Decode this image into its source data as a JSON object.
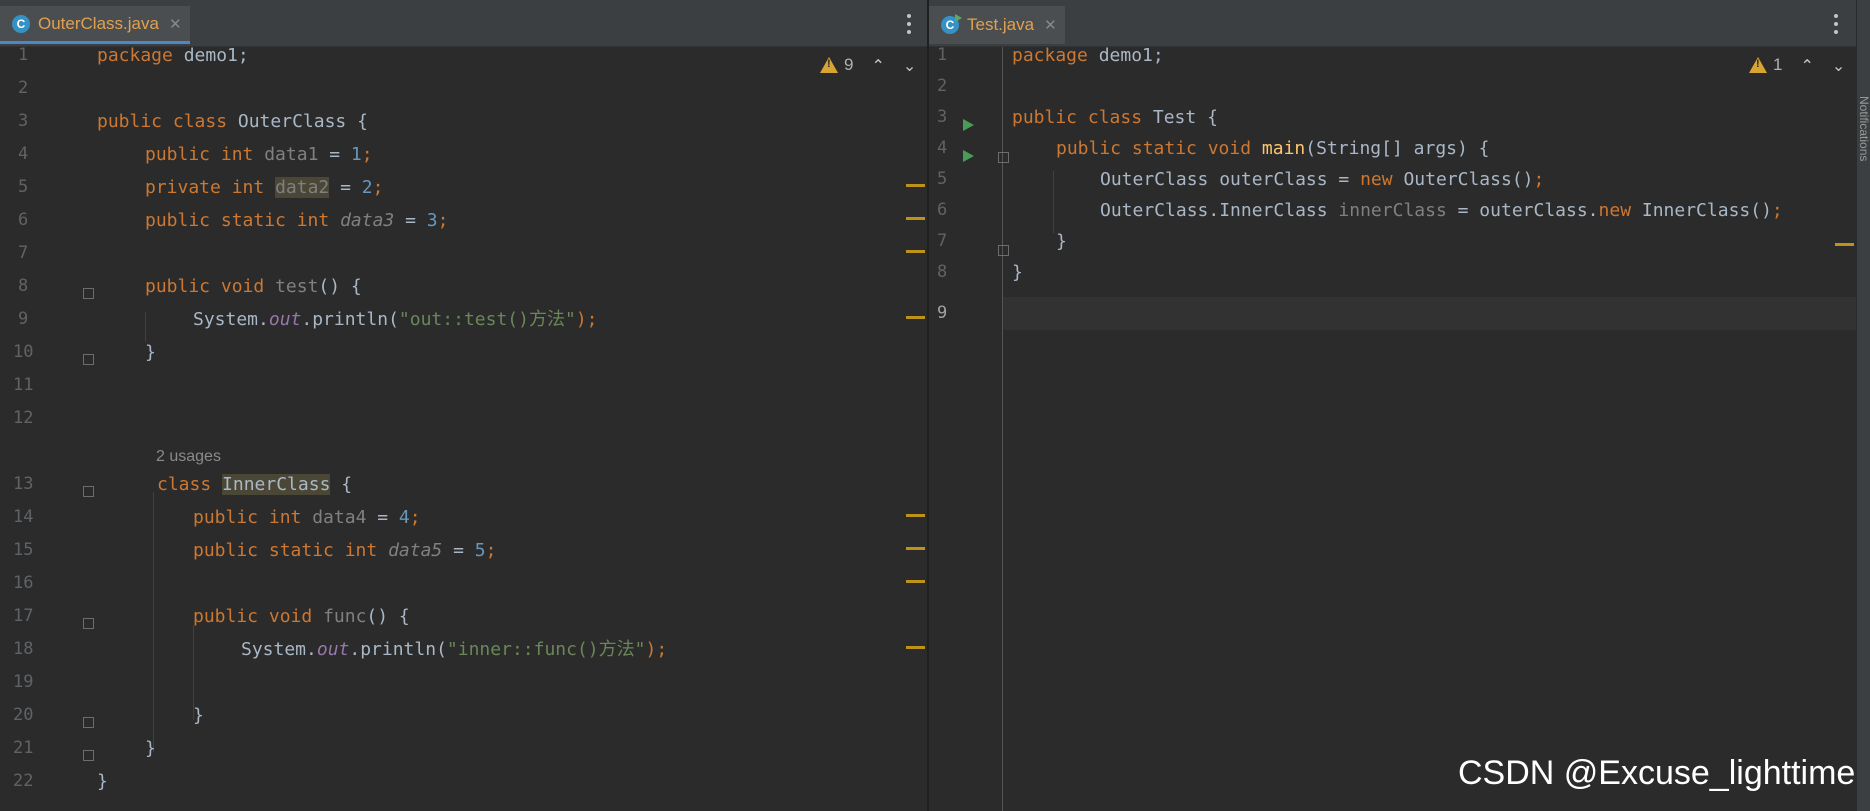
{
  "left": {
    "tab": {
      "icon": "C",
      "name": "OuterClass.java",
      "close": "✕"
    },
    "warnings": {
      "count": "9",
      "up": "⌃",
      "down": "⌄"
    },
    "usages_hint": "2 usages",
    "line_numbers": [
      "1",
      "2",
      "3",
      "4",
      "5",
      "6",
      "7",
      "8",
      "9",
      "10",
      "11",
      "12",
      "13",
      "14",
      "15",
      "16",
      "17",
      "18",
      "19",
      "20",
      "21",
      "22"
    ],
    "code": {
      "l1a": "package",
      "l1b": " demo1;",
      "l3a": "public class",
      "l3b": " OuterClass {",
      "l4a": "public int",
      "l4b": "data1",
      "l4c": " = ",
      "l4d": "1",
      "l4e": ";",
      "l5a": "private int",
      "l5b": "data2",
      "l5c": " = ",
      "l5d": "2",
      "l5e": ";",
      "l6a": "public static int",
      "l6b": "data3",
      "l6c": " = ",
      "l6d": "3",
      "l6e": ";",
      "l8a": "public void",
      "l8b": "test",
      "l8c": "() {",
      "l9a": "System.",
      "l9b": "out",
      "l9c": ".println(",
      "l9d": "\"out::test()方法\"",
      "l9e": ");",
      "l10": "}",
      "l13a": "class",
      "l13b": "InnerClass",
      "l13c": " {",
      "l14a": "public int",
      "l14b": "data4",
      "l14c": " = ",
      "l14d": "4",
      "l14e": ";",
      "l15a": "public static int",
      "l15b": "data5",
      "l15c": " = ",
      "l15d": "5",
      "l15e": ";",
      "l17a": "public void",
      "l17b": "func",
      "l17c": "() {",
      "l18a": "System.",
      "l18b": "out",
      "l18c": ".println(",
      "l18d": "\"inner::func()方法\"",
      "l18e": ");",
      "l20": "}",
      "l21": "}",
      "l22": "}"
    }
  },
  "right": {
    "tab": {
      "icon": "C",
      "name": "Test.java",
      "close": "✕"
    },
    "warnings": {
      "count": "1",
      "up": "⌃",
      "down": "⌄"
    },
    "line_numbers": [
      "1",
      "2",
      "3",
      "4",
      "5",
      "6",
      "7",
      "8",
      "9"
    ],
    "code": {
      "l1a": "package",
      "l1b": " demo1;",
      "l3a": "public class",
      "l3b": " Test {",
      "l4a": "public static void",
      "l4b": "main",
      "l4c": "(String[] args) {",
      "l5a": "OuterClass outerClass = ",
      "l5b": "new",
      "l5c": " OuterClass()",
      "l5d": ";",
      "l6a": "OuterClass.InnerClass ",
      "l6b": "innerClass",
      "l6c": " = outerClass.",
      "l6d": "new",
      "l6e": " InnerClass()",
      "l6f": ";",
      "l7": "}",
      "l8": "}"
    }
  },
  "sidebar_label": "Notifications",
  "watermark": "CSDN @Excuse_lighttime"
}
